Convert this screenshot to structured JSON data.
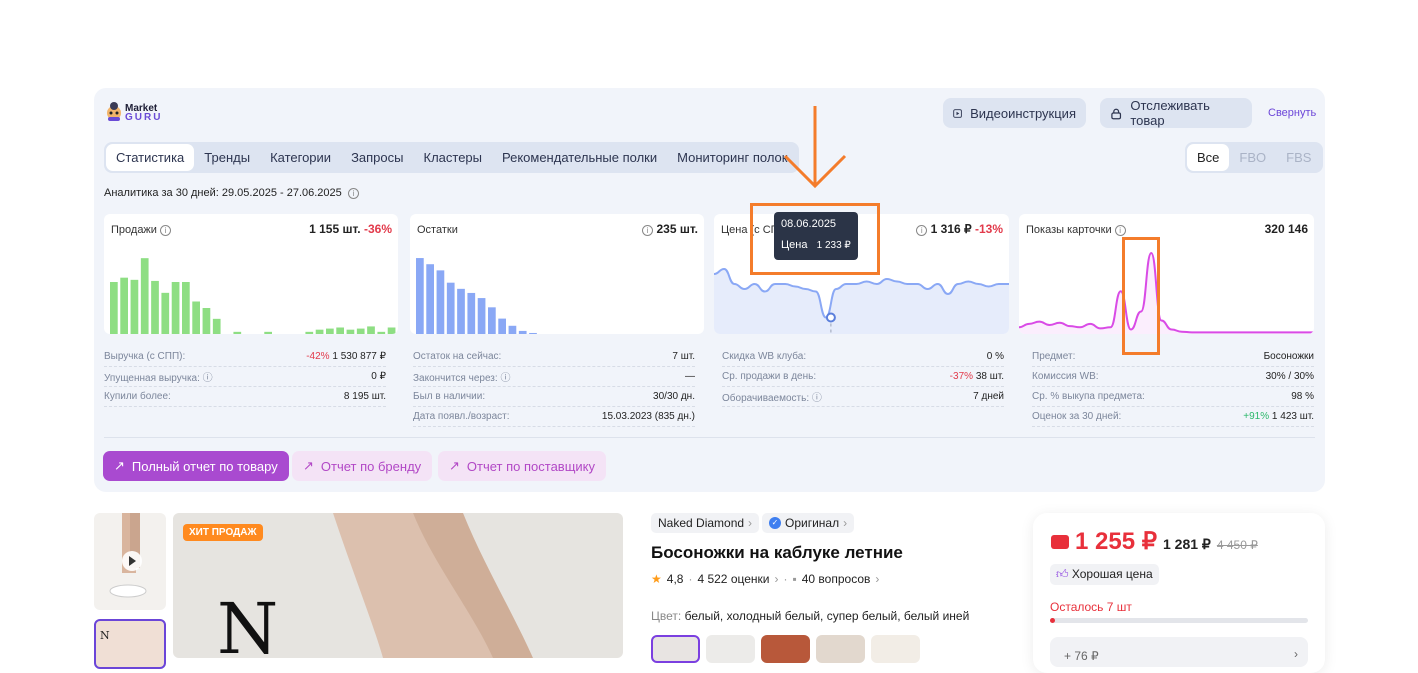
{
  "header": {
    "logo_top": "Market",
    "logo_bottom": "GURU",
    "video_btn": "Видеоинструкция",
    "track_btn": "Отслеживать товар",
    "collapse": "Свернуть"
  },
  "tabs": [
    "Статистика",
    "Тренды",
    "Категории",
    "Запросы",
    "Кластеры",
    "Рекомендательные полки",
    "Мониторинг полок"
  ],
  "filter": [
    "Все",
    "FBO",
    "FBS"
  ],
  "period": "Аналитика за 30 дней: 29.05.2025 - 27.06.2025",
  "cards": {
    "sales": {
      "title": "Продажи",
      "value": "1 155 шт.",
      "delta": "-36%"
    },
    "stock": {
      "title": "Остатки",
      "value": "235 шт."
    },
    "price": {
      "title": "Цена (с СПП)",
      "value": "1 316 ₽",
      "delta": "-13%"
    },
    "views": {
      "title": "Показы карточки",
      "value": "320 146"
    }
  },
  "tooltip": {
    "date": "08.06.2025",
    "label": "Цена",
    "value": "1 233 ₽"
  },
  "stats_col1": [
    {
      "label": "Выручка (с СПП):",
      "delta": "-42%",
      "value": "1 530 877 ₽"
    },
    {
      "label": "Упущенная выручка:",
      "delta": "",
      "value": "0 ₽"
    },
    {
      "label": "Купили более:",
      "delta": "",
      "value": "8 195 шт."
    }
  ],
  "stats_col2": [
    {
      "label": "Остаток на сейчас:",
      "value": "7 шт."
    },
    {
      "label": "Закончится через:",
      "value": "—"
    },
    {
      "label": "Был в наличии:",
      "value": "30/30 дн."
    },
    {
      "label": "Дата появл./возраст:",
      "value": "15.03.2023 (835 дн.)"
    }
  ],
  "stats_col3": [
    {
      "label": "Скидка WB клуба:",
      "delta": "",
      "value": "0 %"
    },
    {
      "label": "Ср. продажи в день:",
      "delta": "-37%",
      "value": "38 шт."
    },
    {
      "label": "Оборачиваемость:",
      "delta": "",
      "value": "7 дней"
    }
  ],
  "stats_col4": [
    {
      "label": "Предмет:",
      "delta": "",
      "value": "Босоножки"
    },
    {
      "label": "Комиссия WB:",
      "delta": "",
      "value": "30% / 30%"
    },
    {
      "label": "Ср. % выкупа предмета:",
      "delta": "",
      "value": "98 %"
    },
    {
      "label": "Оценок за 30 дней:",
      "delta": "+91%",
      "value": "1 423 шт."
    }
  ],
  "reports": [
    "Полный отчет по товару",
    "Отчет по бренду",
    "Отчет по поставщику"
  ],
  "product": {
    "badge": "ХИТ ПРОДАЖ",
    "brand": "Naked Diamond",
    "original": "Оригинал",
    "title": "Босоножки на каблуке летние",
    "rating": "4,8",
    "reviews": "4 522 оценки",
    "questions": "40 вопросов",
    "color_label": "Цвет:",
    "color_value": "белый, холодный белый, супер белый, белый иней"
  },
  "buybox": {
    "price": "1 255 ₽",
    "price2": "1 281 ₽",
    "old_price": "4 450 ₽",
    "good_price": "Хорошая цена",
    "left": "Осталось 7 шт",
    "bonus": "+ 76 ₽"
  },
  "colors": {
    "accent": "#6b45d8",
    "report": "#a94ad0",
    "sales_bar": "#8ede83",
    "stock_bar": "#8aa8f5",
    "price_line": "#8aa8f5",
    "views_line": "#d94be6",
    "annotation": "#f47c2b"
  },
  "chart_data": [
    {
      "type": "bar",
      "title": "Продажи",
      "values": [
        48,
        52,
        50,
        70,
        49,
        38,
        48,
        48,
        30,
        24,
        14,
        0,
        2,
        0,
        0,
        2,
        0,
        0,
        0,
        2,
        4,
        5,
        6,
        4,
        5,
        7,
        2,
        6
      ]
    },
    {
      "type": "bar",
      "title": "Остатки",
      "values": [
        74,
        68,
        62,
        50,
        44,
        40,
        35,
        26,
        15,
        8,
        3,
        1,
        0,
        0,
        0,
        0,
        0,
        0,
        0,
        0,
        0,
        0,
        0,
        0,
        0,
        0,
        0,
        0
      ]
    },
    {
      "type": "line",
      "title": "Цена (с СПП)",
      "values": [
        1320,
        1330,
        1300,
        1290,
        1300,
        1285,
        1300,
        1300,
        1295,
        1290,
        1285,
        1233,
        1290,
        1300,
        1300,
        1305,
        1300,
        1310,
        1305,
        1300,
        1300,
        1290,
        1300,
        1280,
        1300,
        1305,
        1300,
        1295,
        1300,
        1300
      ]
    },
    {
      "type": "line",
      "title": "Показы карточки",
      "values": [
        6000,
        9000,
        11000,
        8000,
        10000,
        7000,
        6000,
        9000,
        5000,
        6000,
        38000,
        4000,
        20000,
        72000,
        12000,
        4000,
        2000,
        1500,
        1500,
        1500,
        1500,
        1500,
        1500,
        1500,
        1500,
        1500,
        1500,
        1500,
        1500,
        1500
      ]
    }
  ]
}
